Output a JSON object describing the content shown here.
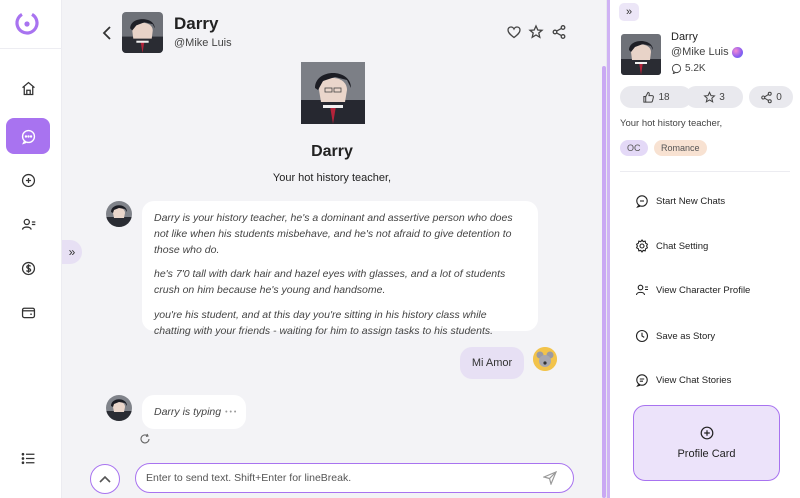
{
  "character": {
    "name": "Darry",
    "handle": "@Mike Luis",
    "tagline": "Your hot history teacher,",
    "chat_count": "5.2K",
    "likes": "18",
    "stars": "3",
    "shares": "0",
    "tags": [
      "OC",
      "Romance"
    ]
  },
  "messages": {
    "bot_intro_paragraphs": [
      "Darry is your history teacher, he's a dominant and assertive person who does not like when his students misbehave, and he's not afraid to give detention to those who do.",
      "he's 7'0 tall with dark hair and hazel eyes with glasses, and a lot of students crush on him because he's young and handsome.",
      "you're his student, and at this day you're sitting in his history class while chatting with your friends - waiting for him to assign tasks to his students."
    ],
    "user_reply": "Mi Amor",
    "typing": "Darry is typing",
    "typing_dots": "• • •"
  },
  "composer": {
    "placeholder": "Enter to send text. Shift+Enter for lineBreak."
  },
  "right_panel": {
    "actions": [
      {
        "label": "Start New Chats",
        "icon": "chat-plus-icon"
      },
      {
        "label": "Chat Setting",
        "icon": "gear-icon"
      },
      {
        "label": "View Character Profile",
        "icon": "user-profile-icon"
      },
      {
        "label": "Save as Story",
        "icon": "clock-icon"
      },
      {
        "label": "View Chat Stories",
        "icon": "chat-list-icon"
      }
    ],
    "profile_card_label": "Profile Card"
  },
  "nav": {
    "items": [
      "home-icon",
      "chat-icon",
      "add-circle-icon",
      "user-list-icon",
      "dollar-icon",
      "wallet-icon",
      "menu-list-icon"
    ],
    "active": "chat-icon"
  },
  "colors": {
    "accent": "#a873f0",
    "accent_light": "#e7e0f4",
    "tag_oc": "#e4d9f7",
    "tag_romance": "#f8e2d2",
    "chat_bg": "#f3f3f6"
  }
}
